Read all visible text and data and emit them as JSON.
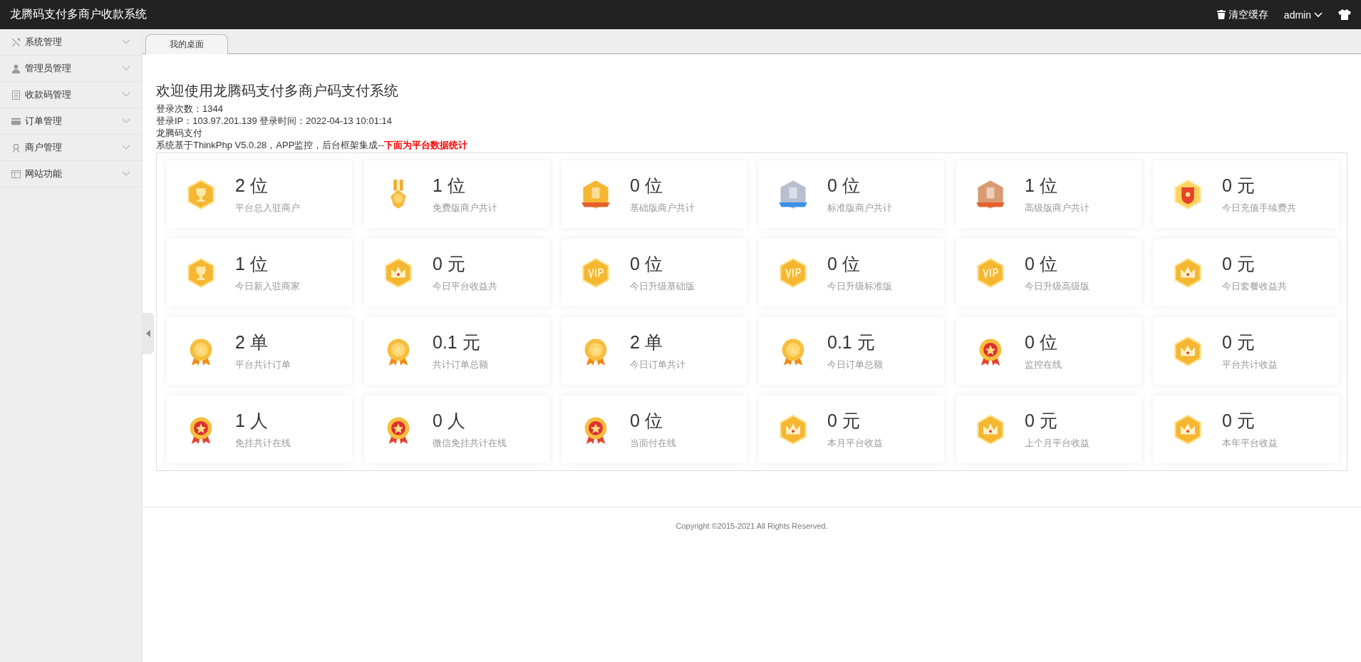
{
  "app_title": "龙腾码支付多商户收款系统",
  "header_actions": {
    "clear_cache": "清空缓存",
    "user": "admin"
  },
  "sidebar": {
    "items": [
      {
        "label": "系统管理",
        "kind": "tools",
        "expanded": false
      },
      {
        "label": "管理员管理",
        "kind": "user",
        "expanded": false
      },
      {
        "label": "收款码管理",
        "kind": "doc",
        "expanded": false
      },
      {
        "label": "订单管理",
        "kind": "card",
        "expanded": false
      },
      {
        "label": "商户管理",
        "kind": "merchant",
        "expanded": false
      },
      {
        "label": "网站功能",
        "kind": "window",
        "expanded": false
      }
    ]
  },
  "tabs": [
    {
      "label": "我的桌面",
      "selected": true
    }
  ],
  "welcome": {
    "title": "欢迎使用龙腾码支付多商户码支付系统",
    "lines": [
      "登录次数：1344",
      "登录IP：103.97.201.139 登录时间：2022-04-13 10:01:14",
      "龙腾码支付",
      "系统基于ThinkPhp V5.0.28，APP监控，后台框架集成--**下面为平台数据统计**"
    ]
  },
  "stats": [
    {
      "value": "2 位",
      "label": "平台总入驻商户",
      "kind": "trophy"
    },
    {
      "value": "1 位",
      "label": "免费版商户共计",
      "kind": "medal"
    },
    {
      "value": "0 位",
      "label": "基础版商户共计",
      "kind": "rank1"
    },
    {
      "value": "0 位",
      "label": "标准版商户共计",
      "kind": "rank2"
    },
    {
      "value": "1 位",
      "label": "高级版商户共计",
      "kind": "rank3"
    },
    {
      "value": "0 元",
      "label": "今日充值手续费共",
      "kind": "shield"
    },
    {
      "value": "1 位",
      "label": "今日新入驻商家",
      "kind": "trophy"
    },
    {
      "value": "0 元",
      "label": "今日平台收益共",
      "kind": "crown"
    },
    {
      "value": "0 位",
      "label": "今日升级基础版",
      "kind": "vip"
    },
    {
      "value": "0 位",
      "label": "今日升级标准版",
      "kind": "vip"
    },
    {
      "value": "0 位",
      "label": "今日升级高级版",
      "kind": "vip"
    },
    {
      "value": "0 元",
      "label": "今日套餐收益共",
      "kind": "crown"
    },
    {
      "value": "2 单",
      "label": "平台共计订单",
      "kind": "rosette"
    },
    {
      "value": "0.1 元",
      "label": "共计订单总额",
      "kind": "rosette"
    },
    {
      "value": "2 单",
      "label": "今日订单共计",
      "kind": "rosette"
    },
    {
      "value": "0.1 元",
      "label": "今日订单总额",
      "kind": "rosette"
    },
    {
      "value": "0 位",
      "label": "监控在线",
      "kind": "star"
    },
    {
      "value": "0 元",
      "label": "平台共计收益",
      "kind": "crown"
    },
    {
      "value": "1 人",
      "label": "免挂共计在线",
      "kind": "star"
    },
    {
      "value": "0 人",
      "label": "微信免挂共计在线",
      "kind": "star"
    },
    {
      "value": "0 位",
      "label": "当面付在线",
      "kind": "star"
    },
    {
      "value": "0 元",
      "label": "本月平台收益",
      "kind": "crown"
    },
    {
      "value": "0 元",
      "label": "上个月平台收益",
      "kind": "crown"
    },
    {
      "value": "0 元",
      "label": "本年平台收益",
      "kind": "crown"
    }
  ],
  "footer": "Copyright ©2015-2021 All Rights Reserved."
}
